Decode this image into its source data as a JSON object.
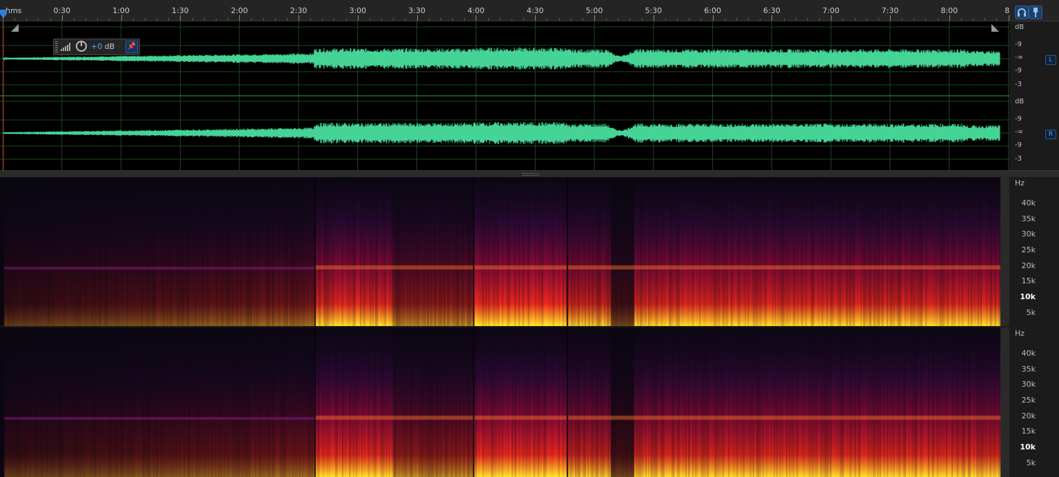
{
  "ruler": {
    "unit_label": "hms",
    "labels": [
      "0:30",
      "1:00",
      "1:30",
      "2:00",
      "2:30",
      "3:00",
      "3:30",
      "4:00",
      "4:30",
      "5:00",
      "5:30",
      "6:00",
      "6:30",
      "7:00",
      "7:30",
      "8:00",
      "8:"
    ]
  },
  "toolbar": {
    "headphones_icon": "headphones-icon",
    "marker_icon": "marker-pin-icon"
  },
  "hud": {
    "gain_value": "+0",
    "gain_unit": "dB"
  },
  "waveform": {
    "channel_left": {
      "badge": "L",
      "unit": "dB",
      "scale": [
        "-9",
        "-∞",
        "-9",
        "-3"
      ]
    },
    "channel_right": {
      "badge": "R",
      "unit": "dB",
      "scale": [
        "-9",
        "-∞",
        "-9",
        "-3"
      ]
    },
    "color": "#45d496"
  },
  "spectral": {
    "unit": "Hz",
    "scale": [
      "40k",
      "35k",
      "30k",
      "25k",
      "20k",
      "15k",
      "10k",
      "5k"
    ]
  },
  "colors": {
    "accent": "#2f7fd8",
    "waveform": "#45d496"
  }
}
